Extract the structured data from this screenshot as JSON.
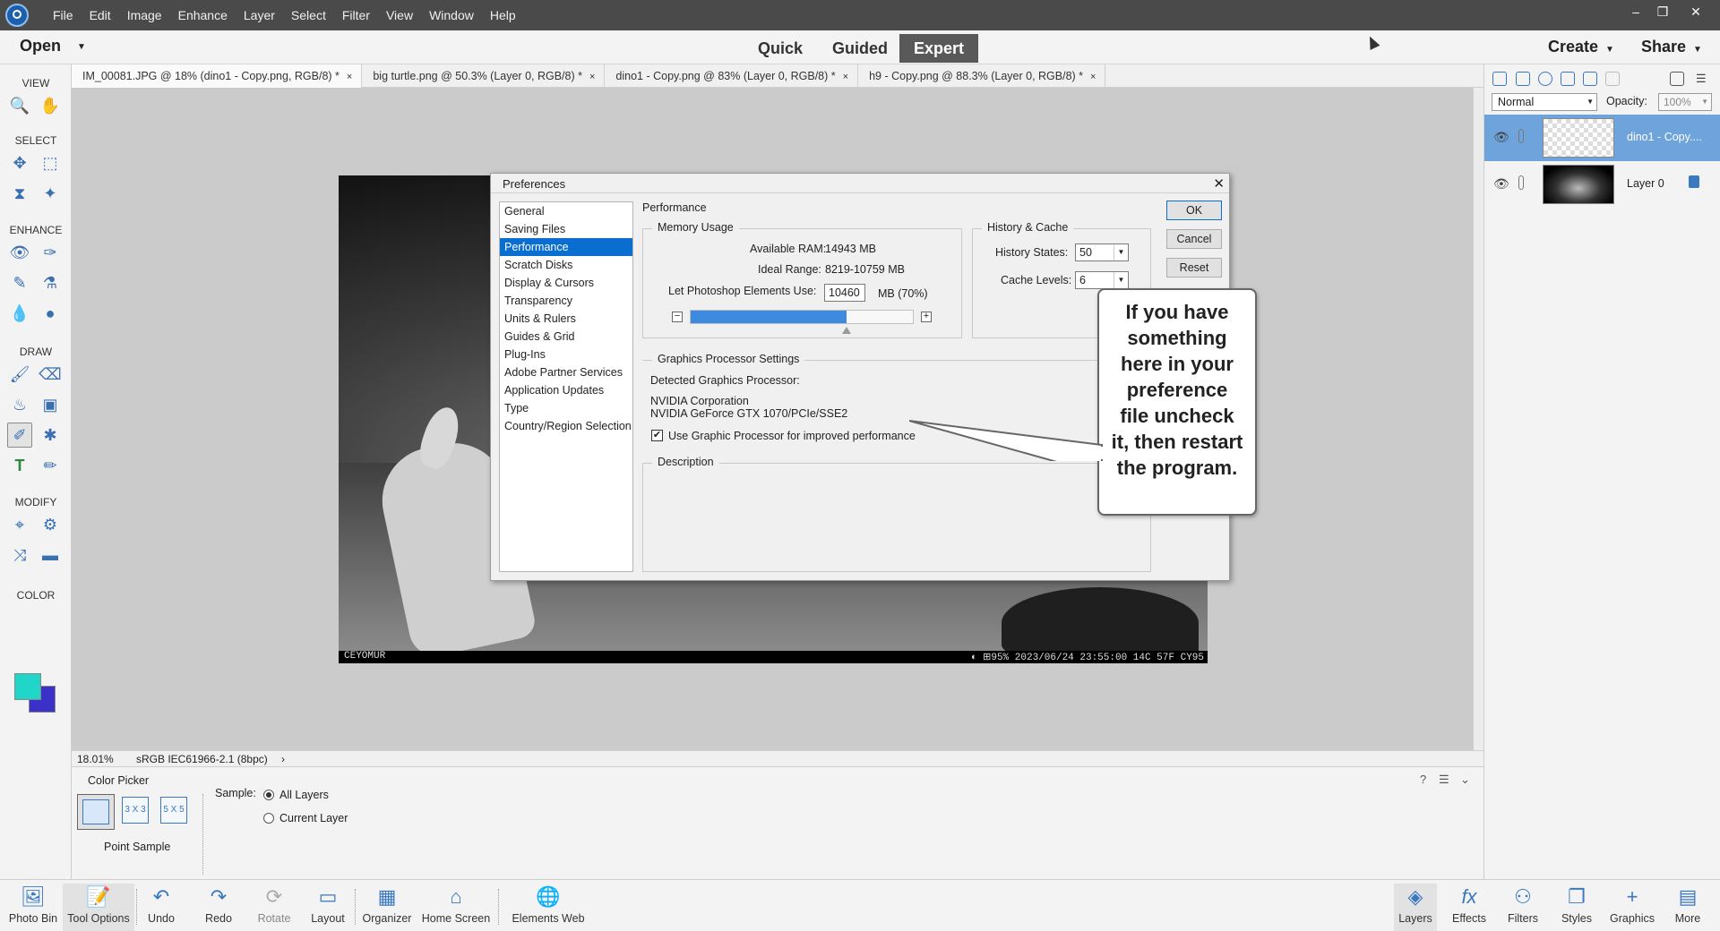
{
  "menu": [
    "File",
    "Edit",
    "Image",
    "Enhance",
    "Layer",
    "Select",
    "Filter",
    "View",
    "Window",
    "Help"
  ],
  "window_controls": {
    "minimize": "–",
    "restore": "❐",
    "close": "✕"
  },
  "modebar": {
    "open": "Open",
    "modes": [
      "Quick",
      "Guided",
      "Expert"
    ],
    "active_mode": "Expert",
    "create": "Create",
    "share": "Share"
  },
  "toolbox": {
    "sections": [
      "VIEW",
      "SELECT",
      "ENHANCE",
      "DRAW",
      "MODIFY",
      "COLOR"
    ],
    "active_tool": "eyedropper-tool",
    "foreground_color": "#1fd6c8",
    "background_color": "#3b30c8"
  },
  "tabs": [
    {
      "title": "IM_00081.JPG @ 18% (dino1 - Copy.png, RGB/8) *",
      "active": true
    },
    {
      "title": "big turtle.png @ 50.3% (Layer 0, RGB/8) *"
    },
    {
      "title": "dino1 - Copy.png @ 83% (Layer 0, RGB/8) *"
    },
    {
      "title": "h9 - Copy.png @ 88.3% (Layer 0, RGB/8) *"
    }
  ],
  "tab_close": "×",
  "photo": {
    "brand": "CEYOMUR",
    "info": "◐         ⊞95%    2023/06/24 23:55:00  14C 57F  CY95"
  },
  "status": {
    "zoom": "18.01%",
    "profile": "sRGB IEC61966-2.1 (8bpc)",
    "arrow": "›"
  },
  "dialog": {
    "title": "Preferences",
    "close": "✕",
    "categories": [
      "General",
      "Saving Files",
      "Performance",
      "Scratch Disks",
      "Display & Cursors",
      "Transparency",
      "Units & Rulers",
      "Guides & Grid",
      "Plug-Ins",
      "Adobe Partner Services",
      "Application Updates",
      "Type",
      "Country/Region Selection"
    ],
    "selected_category": "Performance",
    "heading": "Performance",
    "memory": {
      "group_label": "Memory Usage",
      "available_label": "Available RAM:",
      "available_value": "14943 MB",
      "ideal_label": "Ideal Range:",
      "ideal_value": "8219-10759 MB",
      "use_label": "Let Photoshop Elements Use:",
      "use_value": "10460",
      "use_suffix": "MB (70%)",
      "slider_percent": 70,
      "minus": "−",
      "plus": "+"
    },
    "history": {
      "group_label": "History & Cache",
      "states_label": "History States:",
      "states_value": "50",
      "cache_label": "Cache Levels:",
      "cache_value": "6"
    },
    "gpu": {
      "group_label": "Graphics Processor Settings",
      "detected_label": "Detected Graphics Processor:",
      "vendor": "NVIDIA Corporation",
      "model": "NVIDIA GeForce GTX 1070/PCIe/SSE2",
      "checkbox_label": "Use Graphic Processor for improved performance",
      "checked": true
    },
    "description_label": "Description",
    "buttons": {
      "ok": "OK",
      "cancel": "Cancel",
      "reset": "Reset"
    }
  },
  "callout": "If you have something here in your preference file uncheck it, then restart the program.",
  "layers_panel": {
    "blend_mode": "Normal",
    "opacity_label": "Opacity:",
    "opacity_value": "100%",
    "layers": [
      {
        "name": "dino1 - Copy....",
        "selected": true
      },
      {
        "name": "Layer 0",
        "locked": true
      }
    ]
  },
  "tool_options": {
    "title": "Color Picker",
    "sizes": [
      "3 X 3",
      "5 X 5"
    ],
    "point_label": "Point Sample",
    "sample_label": "Sample:",
    "sample_options": [
      "All Layers",
      "Current Layer"
    ],
    "selected_sample": "All Layers"
  },
  "taskbar": {
    "left": [
      "Photo Bin",
      "Tool Options",
      "Undo",
      "Redo",
      "Rotate",
      "Layout",
      "Organizer",
      "Home Screen",
      "Elements Web"
    ],
    "right": [
      "Layers",
      "Effects",
      "Filters",
      "Styles",
      "Graphics",
      "More"
    ],
    "active": "Tool Options"
  }
}
